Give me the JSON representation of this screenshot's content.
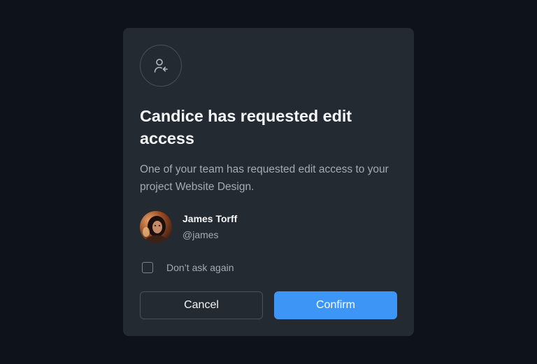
{
  "dialog": {
    "icon": "user-arrow-left-icon",
    "title": "Candice has requested edit access",
    "description": "One of your team has requested edit access to your project Website Design.",
    "user": {
      "name": "James Torff",
      "handle": "@james"
    },
    "checkbox_label": "Don’t ask again",
    "checkbox_checked": false,
    "cancel_label": "Cancel",
    "confirm_label": "Confirm"
  },
  "colors": {
    "background": "#0d121b",
    "modal": "#242a31",
    "accent": "#3d96f6"
  }
}
